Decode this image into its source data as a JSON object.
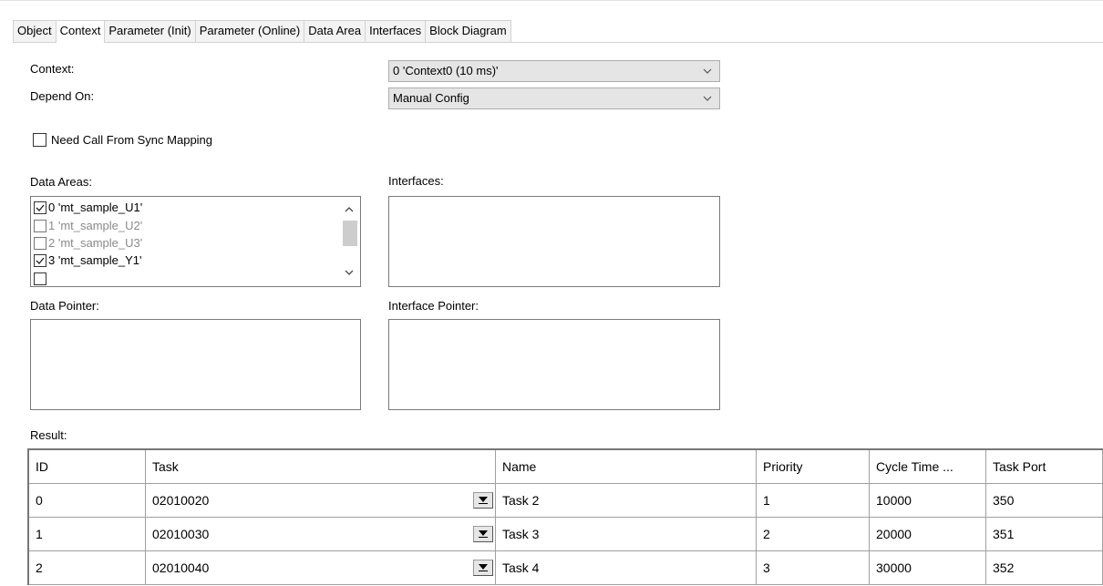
{
  "tabs": [
    {
      "label": "Object"
    },
    {
      "label": "Context"
    },
    {
      "label": "Parameter (Init)"
    },
    {
      "label": "Parameter (Online)"
    },
    {
      "label": "Data Area"
    },
    {
      "label": "Interfaces"
    },
    {
      "label": "Block Diagram"
    }
  ],
  "active_tab": "Context",
  "form": {
    "context_label": "Context:",
    "context_value": "0 'Context0 (10 ms)'",
    "depend_on_label": "Depend On:",
    "depend_on_value": "Manual Config",
    "need_call_label": "Need Call From Sync Mapping",
    "need_call_checked": false,
    "data_areas_label": "Data Areas:",
    "interfaces_label": "Interfaces:",
    "data_pointer_label": "Data Pointer:",
    "interface_pointer_label": "Interface Pointer:",
    "result_label": "Result:"
  },
  "data_areas": [
    {
      "label": "0 'mt_sample_U1'",
      "checked": true,
      "enabled": true
    },
    {
      "label": "1 'mt_sample_U2'",
      "checked": false,
      "enabled": false
    },
    {
      "label": "2 'mt_sample_U3'",
      "checked": false,
      "enabled": false
    },
    {
      "label": "3 'mt_sample_Y1'",
      "checked": true,
      "enabled": true
    }
  ],
  "result": {
    "headers": [
      "ID",
      "Task",
      "Name",
      "Priority",
      "Cycle Time ...",
      "Task Port"
    ],
    "rows": [
      [
        "0",
        "02010020",
        "Task 2",
        "1",
        "10000",
        "350"
      ],
      [
        "1",
        "02010030",
        "Task 3",
        "2",
        "20000",
        "351"
      ],
      [
        "2",
        "02010040",
        "Task 4",
        "3",
        "30000",
        "352"
      ]
    ]
  },
  "icons": {
    "combo_arrow": "chevron-down-icon",
    "scroll_up": "chevron-up-icon",
    "scroll_down": "chevron-down-icon",
    "cell_dropdown": "dropdown-arrow-icon"
  }
}
